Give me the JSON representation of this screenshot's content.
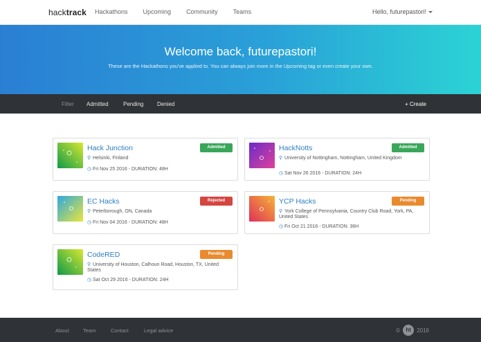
{
  "nav": {
    "brand_light": "hack",
    "brand_bold": "track",
    "links": [
      "Hackathons",
      "Upcoming",
      "Community",
      "Teams"
    ],
    "user": "Hello, futurepastori!"
  },
  "hero": {
    "title": "Welcome back, futurepastori!",
    "subtitle": "These are the Hackathons you've applied to. You can always join more in the Upcoming tag or even create your own."
  },
  "filter": {
    "label": "Filter",
    "items": [
      "Admitted",
      "Pending",
      "Denied"
    ],
    "create": "+ Create"
  },
  "cards": [
    {
      "title": "Hack Junction",
      "status": "Admitted",
      "location": "Helsinki, Finland",
      "date": "Fri Nov 25 2016 - DURATION: 48H"
    },
    {
      "title": "HackNotts",
      "status": "Admitted",
      "location": "University of Nottingham, Nottingham, United Kingdom",
      "date": "Sat Nov 26 2016 - DURATION: 24H"
    },
    {
      "title": "EC Hacks",
      "status": "Rejected",
      "location": "Peterborough, ON, Canada",
      "date": "Fri Nov 04 2016 - DURATION: 48H"
    },
    {
      "title": "YCP Hacks",
      "status": "Pending",
      "location": "York College of Pennsylvania, Country Club Road, York, PA, United States",
      "date": "Fri Oct 21 2016 - DURATION: 36H"
    },
    {
      "title": "CodeRED",
      "status": "Pending",
      "location": "University of Houston, Calhoun Road, Houston, TX, United States",
      "date": "Sat Oct 29 2016 - DURATION: 24H"
    }
  ],
  "footer": {
    "links": [
      "About",
      "Team",
      "Contact",
      "Legal advice"
    ],
    "copyright_symbol": "©",
    "logo": "ht",
    "year": "2016"
  },
  "colors": {
    "accent": "#2c7fc4",
    "admitted": "#3aa65a",
    "rejected": "#d64540",
    "pending": "#e98a2f",
    "dark": "#2f3236"
  },
  "icons": {
    "location": "map-marker-icon",
    "date": "clock-icon",
    "user_dropdown": "caret-down-icon"
  }
}
